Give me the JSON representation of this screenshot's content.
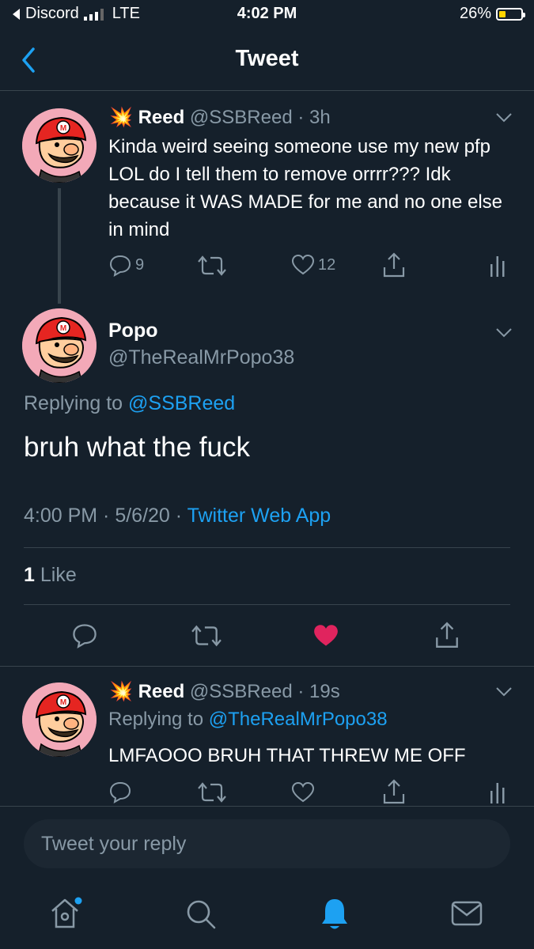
{
  "status_bar": {
    "carrier": "Discord",
    "network": "LTE",
    "time": "4:02 PM",
    "battery": "26%"
  },
  "header": {
    "title": "Tweet"
  },
  "tweets": {
    "first": {
      "emoji": "💥",
      "name": "Reed",
      "handle": "@SSBReed",
      "time": "· 3h",
      "text": "Kinda weird seeing someone use my new pfp LOL do I tell them to remove orrrr??? Idk because it WAS MADE for me and no one else in mind",
      "replies": "9",
      "likes": "12"
    },
    "main": {
      "name": "Popo",
      "handle": "@TheRealMrPopo38",
      "replying_prefix": "Replying to",
      "replying_to": "@SSBReed",
      "text": "bruh what the fuck",
      "timestamp": "4:00 PM · 5/6/20 ·",
      "source": "Twitter Web App",
      "like_count": "1",
      "like_label": "Like"
    },
    "reply": {
      "emoji": "💥",
      "name": "Reed",
      "handle": "@SSBReed",
      "time": "· 19s",
      "replying_prefix": "Replying to",
      "replying_to": "@TheRealMrPopo38",
      "text": "LMFAOOO BRUH THAT THREW ME OFF"
    }
  },
  "reply_input": {
    "placeholder": "Tweet your reply"
  },
  "colors": {
    "background": "#15202b",
    "accent": "#1da1f2",
    "muted": "#8899a6",
    "like": "#e0245e",
    "divider": "#38444d"
  },
  "tabbar": {
    "icons": [
      "home-icon",
      "search-icon",
      "notifications-icon",
      "messages-icon"
    ]
  }
}
